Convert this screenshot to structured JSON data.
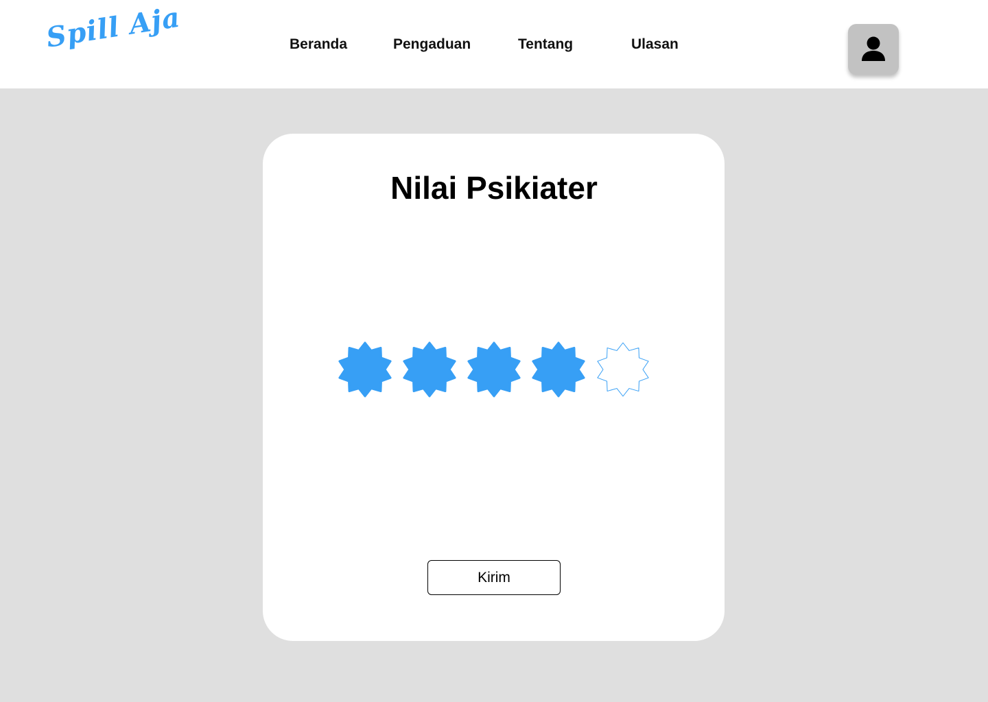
{
  "app": {
    "logo_text": "Spill Aja"
  },
  "nav": {
    "items": [
      {
        "label": "Beranda"
      },
      {
        "label": "Pengaduan"
      },
      {
        "label": "Tentang"
      },
      {
        "label": "Ulasan"
      }
    ],
    "profile_icon": "user-icon"
  },
  "rating_card": {
    "title": "Nilai Psikiater",
    "rating_value": 4,
    "rating_max": 5,
    "star_icon": "starburst-icon",
    "submit_label": "Kirim"
  },
  "colors": {
    "accent": "#379ff5",
    "page_background": "#dfdfdf",
    "card_background": "#ffffff",
    "avatar_button": "#c2c2c2",
    "text": "#000000"
  }
}
